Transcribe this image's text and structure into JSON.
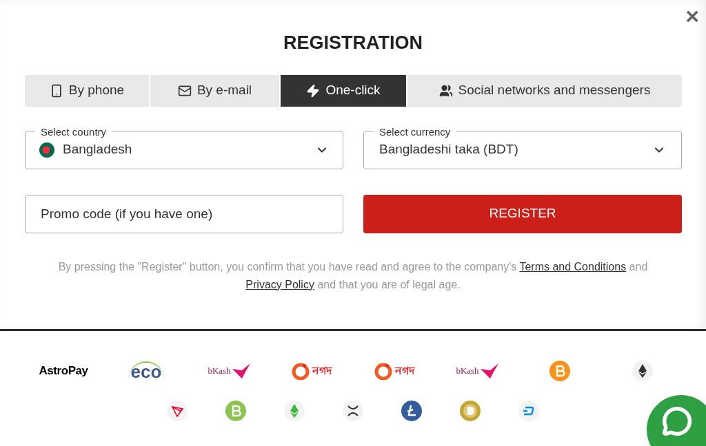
{
  "modal": {
    "title": "REGISTRATION",
    "close": "×"
  },
  "tabs": [
    {
      "label": "By phone",
      "kind": "phone",
      "selected": false
    },
    {
      "label": "By e-mail",
      "kind": "email",
      "selected": false
    },
    {
      "label": "One-click",
      "kind": "bolt",
      "selected": true
    },
    {
      "label": "Social networks and messengers",
      "kind": "users",
      "selected": false
    }
  ],
  "country": {
    "label": "Select country",
    "value": "Bangladesh"
  },
  "currency": {
    "label": "Select currency",
    "value": "Bangladeshi taka (BDT)"
  },
  "promo": {
    "placeholder": "Promo code (if you have one)"
  },
  "register_button": "REGISTER",
  "disclaimer": {
    "before": "By pressing the \"Register\" button, you confirm that you have read and agree to the company's",
    "link1": "Terms and Conditions",
    "middle": "and",
    "link2": "Privacy Policy",
    "after": "and that you are of legal age."
  },
  "payments": [
    [
      {
        "kind": "astropay",
        "label": "AstroPay"
      },
      {
        "kind": "eco",
        "label": "eco"
      },
      {
        "kind": "bkash",
        "label": "bKash"
      },
      {
        "kind": "nagad",
        "label": "নগদ"
      },
      {
        "kind": "nagad",
        "label": "নগদ"
      },
      {
        "kind": "bkash",
        "label": "bKash"
      },
      {
        "kind": "bitcoin"
      },
      {
        "kind": "ethereum"
      }
    ],
    [
      {
        "kind": "tron"
      },
      {
        "kind": "bitcoin-cash"
      },
      {
        "kind": "ethereum-classic"
      },
      {
        "kind": "xrp"
      },
      {
        "kind": "litecoin"
      },
      {
        "kind": "dogecoin"
      },
      {
        "kind": "dash"
      }
    ]
  ]
}
